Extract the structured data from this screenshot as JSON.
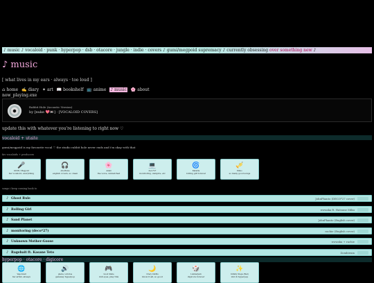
{
  "marquee": {
    "text": "♪ music ♪ vocaloid · punk · hyperpop · dsb · otacore · jungle · indie · covers ♪ gumi/megpoid supremacy ♪ currently obsessing ",
    "highlight": "over something new",
    "end": " ♪"
  },
  "page": {
    "title": "♪ music",
    "tagline": "[ what lives in my ears · always · too loud ]"
  },
  "nav": [
    {
      "label": "⌂ home"
    },
    {
      "label": "✍ diary"
    },
    {
      "label": "✦ art"
    },
    {
      "label": "📖 bookshelf"
    },
    {
      "label": "📺 anime"
    },
    {
      "label": "♪ music",
      "active": true
    },
    {
      "label": "🌸 about"
    }
  ],
  "now_playing": {
    "label": "now_playing.exe",
    "song": "Rabbit Hole (Acoustic Version)",
    "artist": "by [nuke 💖📼] · [VOCALOID COVERS]",
    "note": "update this with whatever you're listening to right now ♡"
  },
  "vocaloid": {
    "title": "vocaloid + utaite",
    "sub": "gumi/megpoid is my favourite vocal ♡ the studio rabbit hole never ends and i'm okay with that",
    "label": "fav vocaloids + producers",
    "cards": [
      {
        "icon": "🎤",
        "name": "GUMI / Megpoid",
        "desc": "fav vocaloid, everything"
      },
      {
        "icon": "🎧",
        "name": "Ado/Pewa",
        "desc": "english covers, so clean"
      },
      {
        "icon": "🌸",
        "name": "Azaki",
        "desc": "the voice, unmatched"
      },
      {
        "icon": "💻",
        "name": "deco*27",
        "desc": "monitoring, vampire, etc"
      },
      {
        "icon": "🌀",
        "name": "Kanaria",
        "desc": "rolling girl forever"
      },
      {
        "icon": "🎺",
        "name": "Kikuo",
        "desc": "so many good songs"
      }
    ]
  },
  "songs": {
    "label": "songs i keep coming back to",
    "rows": [
      {
        "name": "Ghost Rule",
        "artist": "JohnPhanto (DECO*27 cover)"
      },
      {
        "name": "Rolling Girl",
        "artist": "wowaka ft. Hatsune Miku"
      },
      {
        "name": "Sand Planet",
        "artist": "JohnPhanto (English cover)"
      },
      {
        "name": "monitoring (deco*27)",
        "artist": "rachie (English cover)"
      },
      {
        "name": "Unknown Mother-Goose",
        "artist": "wowaka + rachie"
      },
      {
        "name": "Ragebait ft. Kasane Teto",
        "artist": "Zombieum"
      }
    ]
  },
  "hyperpop": {
    "title": "hyperpop · otacore · digicore",
    "cards": [
      {
        "icon": "🌐",
        "name": "Vaporwall",
        "desc": "fav artist, always"
      },
      {
        "icon": "🔊",
        "name": "glaive / ericdoa",
        "desc": "gateway hyperpop"
      },
      {
        "icon": "🎮",
        "name": "Good Smile",
        "desc": "doll eyes, play this"
      },
      {
        "icon": "🌙",
        "name": "Crazy Outfits",
        "desc": "know it all, so good"
      },
      {
        "icon": "🎲",
        "name": "Lumberjack",
        "desc": "digicore forever"
      },
      {
        "icon": "✨",
        "name": "Infinity Steps (Red)",
        "desc": "idol & hyperpop"
      }
    ]
  }
}
